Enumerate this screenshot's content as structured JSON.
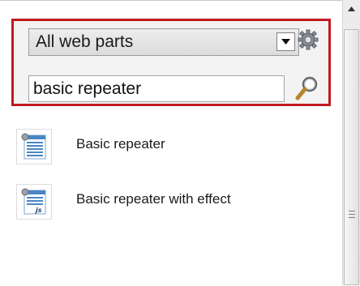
{
  "filter": {
    "category_selected": "All web parts",
    "search_value": "basic repeater"
  },
  "results": [
    {
      "label": "Basic repeater",
      "icon": "webpart-list-icon"
    },
    {
      "label": "Basic repeater with effect",
      "icon": "webpart-js-icon"
    }
  ],
  "colors": {
    "highlight_border": "#c0191f",
    "filter_background": "#f3f3f3"
  }
}
